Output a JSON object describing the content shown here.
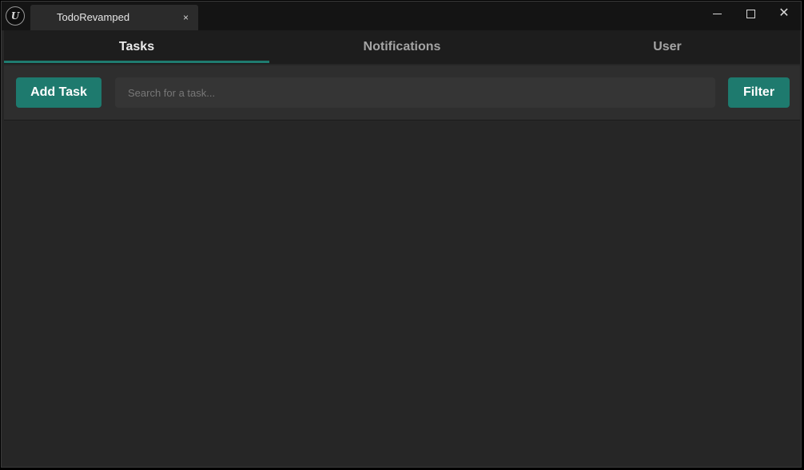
{
  "window": {
    "title": "TodoRevamped",
    "logo_glyph": "U",
    "close_tab_glyph": "×",
    "controls": {
      "minimize_icon": "minimize-icon",
      "maximize_icon": "maximize-icon",
      "close_icon": "close-icon",
      "close_glyph": "✕"
    }
  },
  "tabs": [
    {
      "label": "Tasks",
      "active": true
    },
    {
      "label": "Notifications",
      "active": false
    },
    {
      "label": "User",
      "active": false
    }
  ],
  "toolbar": {
    "add_label": "Add Task",
    "search_placeholder": "Search for a task...",
    "search_value": "",
    "filter_label": "Filter"
  },
  "colors": {
    "accent": "#1e7a6e",
    "background": "#262626",
    "titlebar": "#141414",
    "tabbar": "#1d1d1d"
  }
}
